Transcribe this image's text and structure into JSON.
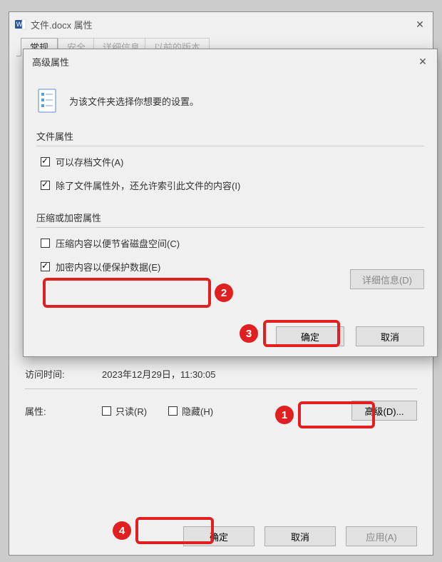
{
  "parent": {
    "title": "文件.docx 属性",
    "tabs": {
      "general": "常规",
      "security": "安全",
      "details": "详细信息",
      "previous": "以前的版本"
    },
    "access_label": "访问时间:",
    "access_value": "2023年12月29日，11:30:05",
    "attr_label": "属性:",
    "readonly": "只读(R)",
    "hidden": "隐藏(H)",
    "advanced_btn": "高级(D)...",
    "ok": "确定",
    "cancel": "取消",
    "apply": "应用(A)"
  },
  "child": {
    "title": "高级属性",
    "desc": "为该文件夹选择你想要的设置。",
    "file_attr_group": "文件属性",
    "archive": "可以存档文件(A)",
    "index": "除了文件属性外，还允许索引此文件的内容(I)",
    "compress_group": "压缩或加密属性",
    "compress": "压缩内容以便节省磁盘空间(C)",
    "encrypt": "加密内容以便保护数据(E)",
    "details_btn": "详细信息(D)",
    "ok": "确定",
    "cancel": "取消"
  },
  "steps": {
    "s1": "1",
    "s2": "2",
    "s3": "3",
    "s4": "4"
  }
}
